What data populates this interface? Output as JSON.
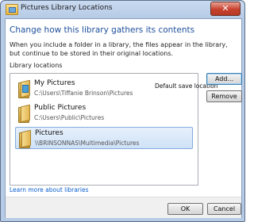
{
  "window": {
    "title": "Pictures Library Locations",
    "close_glyph": "✕"
  },
  "content": {
    "heading": "Change how this library gathers its contents",
    "description": "When you include a folder in a library, the files appear in the library, but continue to be stored in their original locations.",
    "library_locations_label": "Library locations"
  },
  "locations": [
    {
      "name": "My Pictures",
      "path": "C:\\Users\\Tiffanie Brinson\\Pictures",
      "badge": "Default save location",
      "icon": "pictures-folder-icon",
      "selected": false
    },
    {
      "name": "Public Pictures",
      "path": "C:\\Users\\Public\\Pictures",
      "badge": "",
      "icon": "folder-icon",
      "selected": false
    },
    {
      "name": "Pictures",
      "path": "\\\\BRINSONNAS\\Multimedia\\Pictures",
      "badge": "",
      "icon": "folder-icon",
      "selected": true
    }
  ],
  "buttons": {
    "add": "Add...",
    "remove": "Remove",
    "ok": "OK",
    "cancel": "Cancel"
  },
  "link": {
    "learn_more": "Learn more about libraries"
  },
  "colors": {
    "heading": "#1e4f9c",
    "link": "#0b5fcf",
    "selection": "#cfe2f7"
  }
}
